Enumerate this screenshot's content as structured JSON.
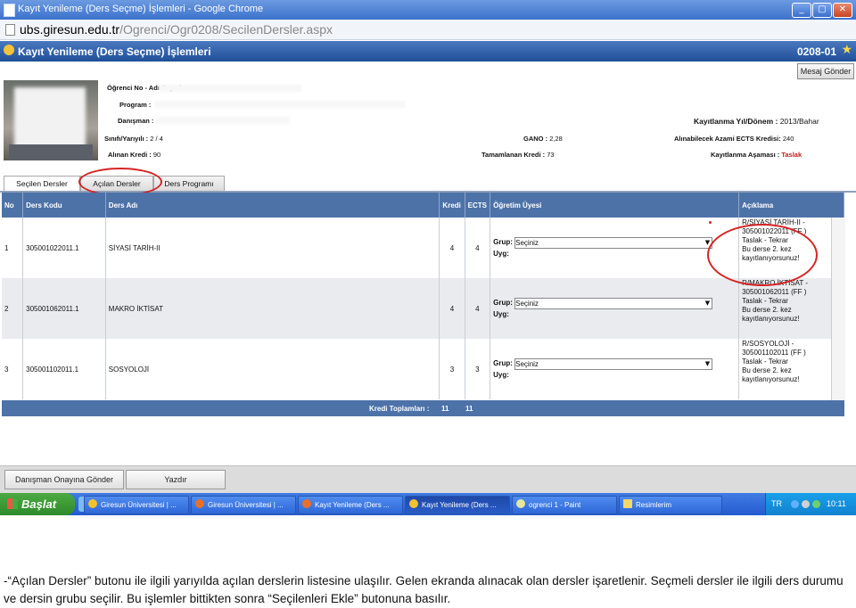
{
  "window": {
    "title": "Kayıt Yenileme (Ders Seçme) İşlemleri - Google Chrome",
    "buttons": [
      "_",
      "▢",
      "✕"
    ]
  },
  "address": {
    "host": "ubs.giresun.edu.tr",
    "path": "/Ogrenci/Ogr0208/SecilenDersler.aspx"
  },
  "app": {
    "title": "Kayıt Yenileme (Ders Seçme) İşlemleri",
    "code": "0208-01",
    "send_message": "Mesaj Gönder"
  },
  "student": {
    "no_label": "Öğrenci No - Adı Soyadı :",
    "program_label": "Program :",
    "advisor_label": "Danışman :",
    "class_label": "Sınıfı/Yarıyılı :",
    "class_value": "2 / 4",
    "credit_label": "Alınan Kredi :",
    "credit_value": "90",
    "gano_label": "GANO :",
    "gano_value": "2,28",
    "completed_label": "Tamamlanan Kredi :",
    "completed_value": "73",
    "term_label": "Kayıtlanma Yıl/Dönem :",
    "term_value": "2013/Bahar",
    "max_ects_label": "Alınabilecek Azami ECTS Kredisi:",
    "max_ects_value": "240",
    "stage_label": "Kayıtlanma Aşaması :",
    "stage_value": "Taslak"
  },
  "tabs": [
    "Seçilen Dersler",
    "Açılan Dersler",
    "Ders Programı"
  ],
  "grid": {
    "headers": [
      "No",
      "Ders Kodu",
      "Ders Adı",
      "Kredi",
      "ECTS",
      "Öğretim Üyesi",
      "Açıklama"
    ],
    "grup_label": "Grup:",
    "uyg_label": "Uyg:",
    "select_placeholder": "Seçiniz",
    "rows": [
      {
        "no": "1",
        "code": "305001022011.1",
        "name": "SİYASİ TARİH-II",
        "kredi": "4",
        "ects": "4",
        "aciklama": [
          "R/SİYASİ TARİH-II -",
          "305001022011 (FF )",
          "Taslak - Tekrar",
          "Bu derse 2. kez",
          "kayıtlanıyorsunuz!"
        ]
      },
      {
        "no": "2",
        "code": "305001062011.1",
        "name": "MAKRO İKTİSAT",
        "kredi": "4",
        "ects": "4",
        "aciklama": [
          "R/MAKRO İKTİSAT -",
          "305001062011 (FF )",
          "Taslak - Tekrar",
          "Bu derse 2. kez",
          "kayıtlanıyorsunuz!"
        ]
      },
      {
        "no": "3",
        "code": "305001102011.1",
        "name": "SOSYOLOJİ",
        "kredi": "3",
        "ects": "3",
        "aciklama": [
          "R/SOSYOLOJİ -",
          "305001102011 (FF )",
          "Taslak - Tekrar",
          "Bu derse 2. kez",
          "kayıtlanıyorsunuz!"
        ]
      }
    ],
    "totals_label": "Kredi Toplamları :",
    "total_kredi": "11",
    "total_ects": "11"
  },
  "buttons": {
    "submit": "Danışman Onayına Gönder",
    "print": "Yazdır"
  },
  "taskbar": {
    "start": "Başlat",
    "tasks": [
      "Giresun Üniversitesi | ...",
      "Giresun Üniversitesi | ...",
      "Kayıt Yenileme (Ders ...",
      "Kayıt Yenileme (Ders ...",
      "ogrenci 1 - Paint",
      "Resimlerim"
    ],
    "lang": "TR",
    "clock": "10:11"
  },
  "caption": "-“Açılan Dersler” butonu ile ilgili yarıyılda açılan derslerin listesine ulaşılır. Gelen ekranda alınacak olan dersler işaretlenir. Seçmeli dersler ile ilgili ders durumu ve dersin grubu seçilir. Bu işlemler  bittikten sonra “Seçilenleri Ekle” butonuna basılır."
}
